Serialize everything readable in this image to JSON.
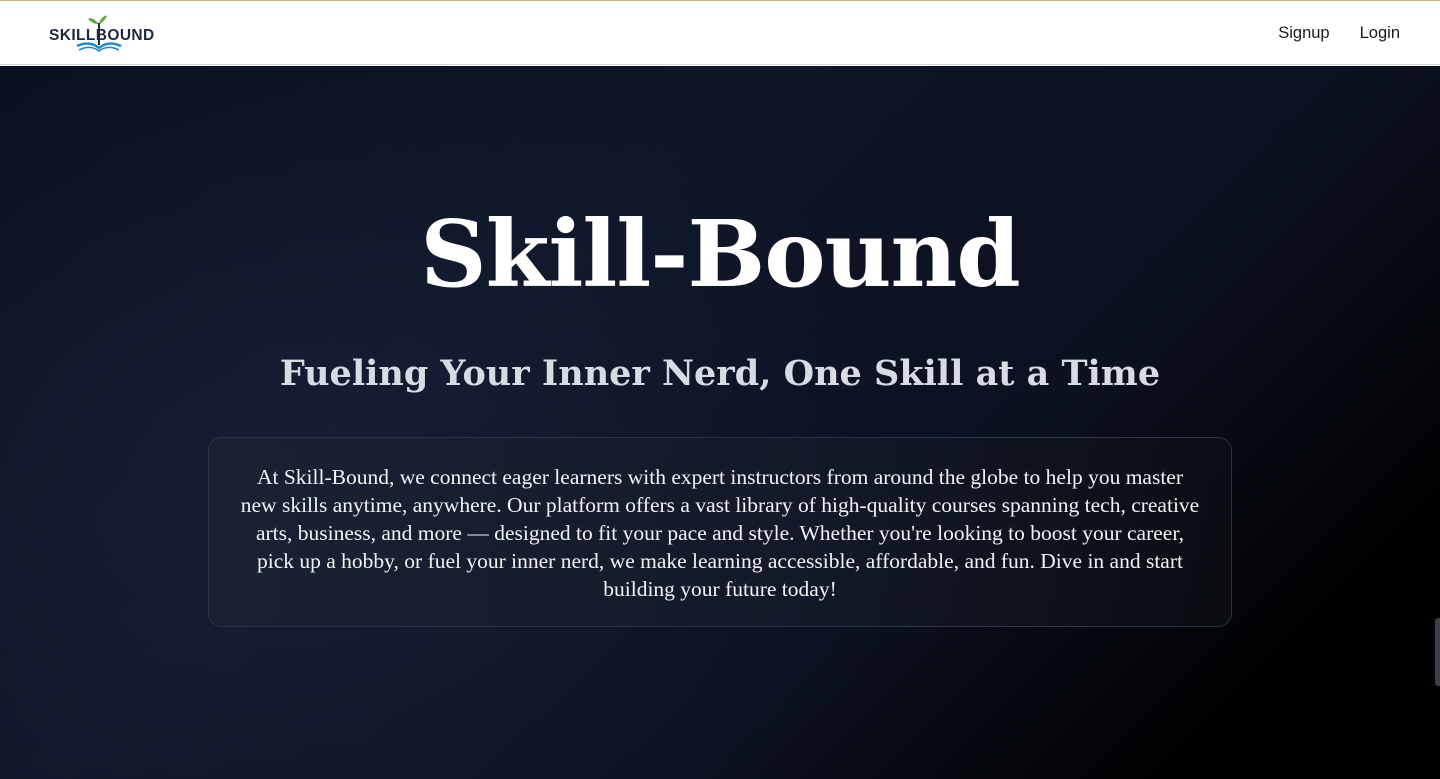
{
  "navbar": {
    "logo_text": "SKILLBOUND",
    "links": [
      {
        "label": "Signup"
      },
      {
        "label": "Login"
      }
    ]
  },
  "hero": {
    "title": "Skill-Bound",
    "subtitle": "Fueling Your Inner Nerd, One Skill at a Time",
    "description": "At Skill-Bound, we connect eager learners with expert instructors from around the globe to help you master new skills anytime, anywhere. Our platform offers a vast library of high-quality courses spanning tech, creative arts, business, and more — designed to fit your pace and style. Whether you're looking to boost your career, pick up a hobby, or fuel your inner nerd, we make learning accessible, affordable, and fun. Dive in and start building your future today!"
  },
  "colors": {
    "logo_text": "#1f2a3a",
    "logo_book": "#1e88c7",
    "logo_leaf": "#5aa83c",
    "hero_bg": "#0b1020",
    "hero_title": "#ffffff",
    "hero_subtitle": "#d7dbe3"
  },
  "icons": {
    "logo": "open-book-with-sprout-icon"
  }
}
